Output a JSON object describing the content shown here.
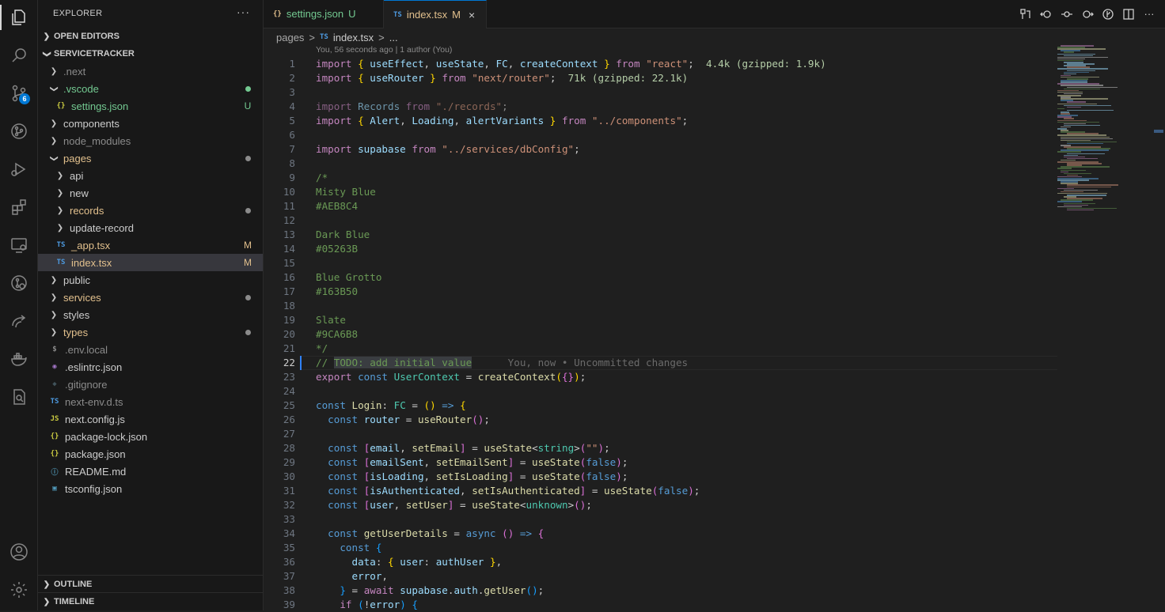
{
  "explorer": {
    "title": "EXPLORER",
    "more": "···",
    "open_editors": "OPEN EDITORS",
    "project": "SERVICETRACKER",
    "outline": "OUTLINE",
    "timeline": "TIMELINE"
  },
  "activity": {
    "source_control_badge": "6"
  },
  "tree": [
    {
      "label": ".next",
      "icon": "chevron-right",
      "color": "#8b8b8b"
    },
    {
      "label": ".vscode",
      "icon": "chevron-down",
      "color": "#73c991",
      "status": "dot-green"
    },
    {
      "label": "settings.json",
      "icon": "{}",
      "color": "#73c991",
      "status": "U"
    },
    {
      "label": "components",
      "icon": "chevron-right",
      "color": "#cccccc"
    },
    {
      "label": "node_modules",
      "icon": "chevron-right",
      "color": "#8b8b8b"
    },
    {
      "label": "pages",
      "icon": "chevron-down",
      "color": "#e2c08d",
      "status": "dot-grey"
    },
    {
      "label": "api",
      "icon": "chevron-right",
      "color": "#cccccc"
    },
    {
      "label": "new",
      "icon": "chevron-right",
      "color": "#cccccc"
    },
    {
      "label": "records",
      "icon": "chevron-right",
      "color": "#e2c08d",
      "status": "dot-grey"
    },
    {
      "label": "update-record",
      "icon": "chevron-right",
      "color": "#cccccc"
    },
    {
      "label": "_app.tsx",
      "icon": "TS",
      "color": "#e2c08d",
      "status": "M"
    },
    {
      "label": "index.tsx",
      "icon": "TS",
      "color": "#e2c08d",
      "status": "M"
    },
    {
      "label": "public",
      "icon": "chevron-right",
      "color": "#cccccc"
    },
    {
      "label": "services",
      "icon": "chevron-right",
      "color": "#e2c08d",
      "status": "dot-grey"
    },
    {
      "label": "styles",
      "icon": "chevron-right",
      "color": "#cccccc"
    },
    {
      "label": "types",
      "icon": "chevron-right",
      "color": "#e2c08d",
      "status": "dot-grey"
    },
    {
      "label": ".env.local",
      "icon": "$",
      "color": "#8b8b8b"
    },
    {
      "label": ".eslintrc.json",
      "icon": "eslint",
      "color": "#cccccc"
    },
    {
      "label": ".gitignore",
      "icon": "git",
      "color": "#8b8b8b"
    },
    {
      "label": "next-env.d.ts",
      "icon": "TS",
      "color": "#8b8b8b"
    },
    {
      "label": "next.config.js",
      "icon": "JS",
      "color": "#cccccc"
    },
    {
      "label": "package-lock.json",
      "icon": "{}",
      "color": "#cccccc"
    },
    {
      "label": "package.json",
      "icon": "{}",
      "color": "#cccccc"
    },
    {
      "label": "README.md",
      "icon": "info",
      "color": "#cccccc"
    },
    {
      "label": "tsconfig.json",
      "icon": "ts-config",
      "color": "#cccccc"
    }
  ],
  "tabs": [
    {
      "label": "settings.json",
      "icon": "{}",
      "status": "U"
    },
    {
      "label": "index.tsx",
      "icon": "TS",
      "status": "M",
      "close": "×"
    }
  ],
  "breadcrumb": {
    "folder": "pages",
    "sep": ">",
    "file_icon": "TS",
    "file": "index.tsx",
    "more": "..."
  },
  "editor": {
    "blame_top": "You, 56 seconds ago | 1 author (You)",
    "line_numbers": [
      "1",
      "2",
      "3",
      "4",
      "5",
      "6",
      "7",
      "8",
      "9",
      "10",
      "11",
      "12",
      "13",
      "14",
      "15",
      "16",
      "17",
      "18",
      "19",
      "20",
      "21",
      "22",
      "23",
      "24",
      "25",
      "26",
      "27",
      "28",
      "29",
      "30",
      "31",
      "32",
      "33",
      "34",
      "35",
      "36",
      "37",
      "38",
      "39"
    ],
    "import_sizes": {
      "react": "4.4k (gzipped: 1.9k)",
      "router": "71k (gzipped: 22.1k)"
    },
    "inline_blame": "You, now • Uncommitted changes",
    "comment_lines": [
      "/*",
      "Misty Blue",
      "#AEB8C4",
      "",
      "Dark Blue",
      "#05263B",
      "",
      "Blue Grotto",
      "#163B50",
      "",
      "Slate",
      "#9CA6B8",
      "*/"
    ],
    "todo": {
      "prefix": "// ",
      "tag": "TODO",
      "text": ": add initial value"
    }
  }
}
